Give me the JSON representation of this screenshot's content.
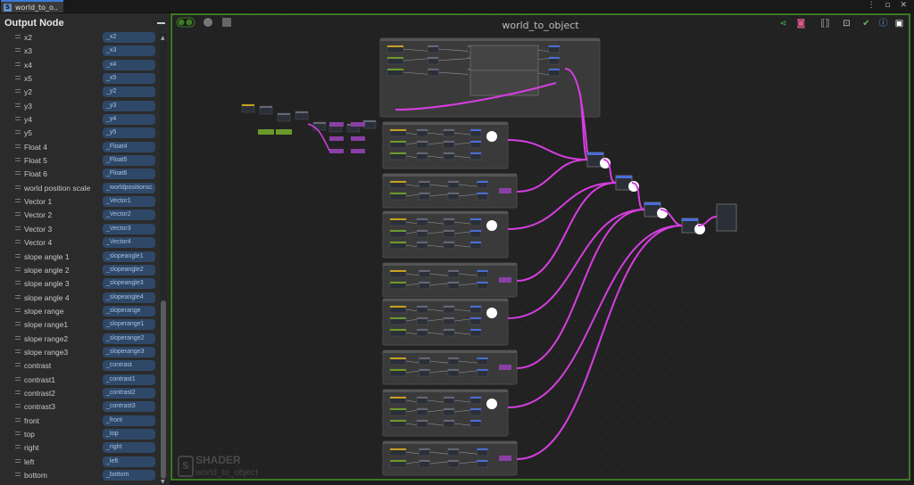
{
  "tab": {
    "title": "world_to_o..",
    "icon": "S"
  },
  "sidebar": {
    "title": "Output Node",
    "rows": [
      {
        "label": "x2",
        "value": "_x2"
      },
      {
        "label": "x3",
        "value": "_x3"
      },
      {
        "label": "x4",
        "value": "_x4"
      },
      {
        "label": "x5",
        "value": "_x5"
      },
      {
        "label": "y2",
        "value": "_y2"
      },
      {
        "label": "y3",
        "value": "_y3"
      },
      {
        "label": "y4",
        "value": "_y4"
      },
      {
        "label": "y5",
        "value": "_y5"
      },
      {
        "label": "Float 4",
        "value": "_Float4"
      },
      {
        "label": "Float 5",
        "value": "_Float5"
      },
      {
        "label": "Float 6",
        "value": "_Float6"
      },
      {
        "label": "world position scale",
        "value": "_worldpositionsc"
      },
      {
        "label": "Vector 1",
        "value": "_Vector1"
      },
      {
        "label": "Vector 2",
        "value": "_Vector2"
      },
      {
        "label": "Vector 3",
        "value": "_Vector3"
      },
      {
        "label": "Vector 4",
        "value": "_Vector4"
      },
      {
        "label": "slope angle 1",
        "value": "_slopeangle1"
      },
      {
        "label": "slope angle 2",
        "value": "_slopeangle2"
      },
      {
        "label": "slope angle 3",
        "value": "_slopeangle3"
      },
      {
        "label": "slope angle 4",
        "value": "_slopeangle4"
      },
      {
        "label": "slope range",
        "value": "_sloperange"
      },
      {
        "label": "slope range1",
        "value": "_sloperange1"
      },
      {
        "label": "slope range2",
        "value": "_sloperange2"
      },
      {
        "label": "slope range3",
        "value": "_sloperange3"
      },
      {
        "label": "contrast",
        "value": "_contrast"
      },
      {
        "label": "contrast1",
        "value": "_contrast1"
      },
      {
        "label": "contrast2",
        "value": "_contrast2"
      },
      {
        "label": "contrast3",
        "value": "_contrast3"
      },
      {
        "label": "front",
        "value": "_front"
      },
      {
        "label": "top",
        "value": "_top"
      },
      {
        "label": "right",
        "value": "_right"
      },
      {
        "label": "left",
        "value": "_left"
      },
      {
        "label": "bottom",
        "value": "_bottom"
      }
    ]
  },
  "canvas": {
    "title": "world_to_object",
    "watermark_type": "SHADER",
    "watermark_name": "world_to_object"
  },
  "colors": {
    "accent": "#3b7a25",
    "wire": "#d63ee0",
    "field": "#2f4868"
  }
}
